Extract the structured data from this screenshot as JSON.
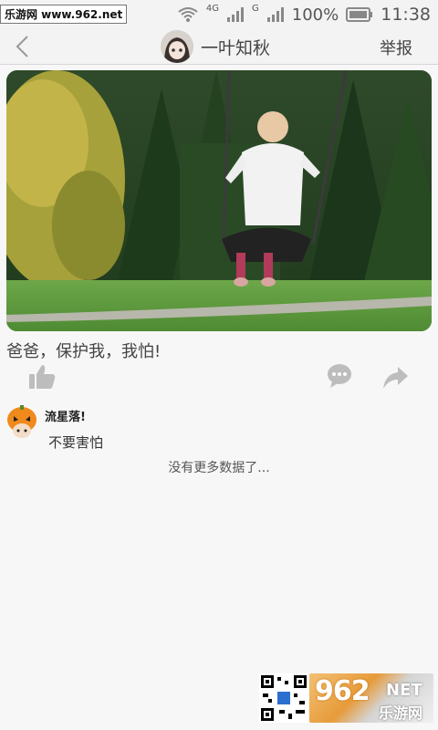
{
  "status_bar": {
    "watermark": "乐游网 www.962.net",
    "network_4g": "4G",
    "network_g": "G",
    "battery_percent": "100%",
    "time": "11:38"
  },
  "header": {
    "title": "一叶知秋",
    "report_label": "举报"
  },
  "post": {
    "caption": "爸爸，保护我，我怕!"
  },
  "comments": [
    {
      "author": "流星落!",
      "text": "不要害怕"
    }
  ],
  "list_end_text": "没有更多数据了...",
  "brand": {
    "number": "962",
    "suffix": "NET",
    "site_cn": "乐游网"
  },
  "colors": {
    "background": "#f7f7f7",
    "header_bg": "#f3f3f3",
    "icon_gray": "#bdbdbd"
  }
}
